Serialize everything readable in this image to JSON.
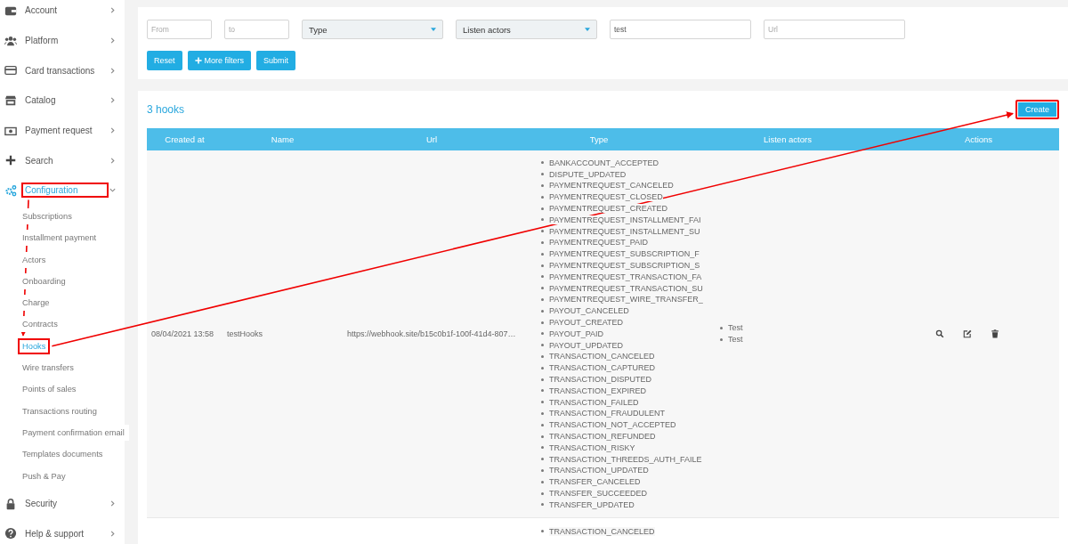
{
  "sidebar": {
    "items": [
      {
        "label": "Account",
        "kind": "wallet",
        "expanded": false,
        "selected": false,
        "highlighted": false
      },
      {
        "label": "Platform",
        "kind": "users",
        "expanded": false,
        "selected": false,
        "highlighted": false
      },
      {
        "label": "Card transactions",
        "kind": "card",
        "expanded": false,
        "selected": false,
        "highlighted": false
      },
      {
        "label": "Catalog",
        "kind": "store",
        "expanded": false,
        "selected": false,
        "highlighted": false
      },
      {
        "label": "Payment request",
        "kind": "money",
        "expanded": false,
        "selected": false,
        "highlighted": false
      },
      {
        "label": "Search",
        "kind": "plus",
        "expanded": false,
        "selected": false,
        "highlighted": false
      },
      {
        "label": "Configuration",
        "kind": "cogs",
        "expanded": true,
        "selected": true,
        "highlighted": true,
        "children": [
          {
            "label": "Subscriptions",
            "selected": false,
            "highlighted": false
          },
          {
            "label": "Installment payment",
            "selected": false,
            "highlighted": false
          },
          {
            "label": "Actors",
            "selected": false,
            "highlighted": false
          },
          {
            "label": "Onboarding",
            "selected": false,
            "highlighted": false
          },
          {
            "label": "Charge",
            "selected": false,
            "highlighted": false
          },
          {
            "label": "Contracts",
            "selected": false,
            "highlighted": false
          },
          {
            "label": "Hooks",
            "selected": true,
            "highlighted": true
          },
          {
            "label": "Wire transfers",
            "selected": false,
            "highlighted": false
          },
          {
            "label": "Points of sales",
            "selected": false,
            "highlighted": false
          },
          {
            "label": "Transactions routing",
            "selected": false,
            "highlighted": false
          },
          {
            "label": "Payment confirmation email",
            "selected": false,
            "highlighted": false
          },
          {
            "label": "Templates documents",
            "selected": false,
            "highlighted": false
          },
          {
            "label": "Push & Pay",
            "selected": false,
            "highlighted": false
          }
        ]
      },
      {
        "label": "Security",
        "kind": "lock",
        "expanded": false,
        "selected": false,
        "highlighted": false
      },
      {
        "label": "Help & support",
        "kind": "question",
        "expanded": false,
        "selected": false,
        "highlighted": false
      }
    ]
  },
  "filters": {
    "fields": [
      {
        "kind": "input",
        "placeholder": "From"
      },
      {
        "kind": "input",
        "placeholder": "to"
      },
      {
        "kind": "select",
        "value": "Type"
      },
      {
        "kind": "select",
        "value": "Listen actors"
      },
      {
        "kind": "input",
        "value": "test"
      },
      {
        "kind": "input",
        "placeholder": "Url"
      }
    ],
    "buttons": [
      {
        "label": "Reset",
        "kind": "plain"
      },
      {
        "label": "More filters",
        "kind": "add"
      },
      {
        "label": "Submit",
        "kind": "plain"
      }
    ]
  },
  "hooks": {
    "count": "3 hooks",
    "create_button": {
      "label": "Create",
      "highlighted": true
    },
    "table": {
      "columns": [
        "Created at",
        "Name",
        "Url",
        "Type",
        "Listen actors",
        "Actions"
      ],
      "rows": [
        {
          "created_at": "08/04/2021 13:58",
          "name": "testHooks",
          "url": "https://webhook.site/b15c0b1f-100f-41d4-807…",
          "types": [
            "BANKACCOUNT_ACCEPTED",
            "DISPUTE_UPDATED",
            "PAYMENTREQUEST_CANCELED",
            "PAYMENTREQUEST_CLOSED",
            "PAYMENTREQUEST_CREATED",
            "PAYMENTREQUEST_INSTALLMENT_FAI",
            "PAYMENTREQUEST_INSTALLMENT_SU",
            "PAYMENTREQUEST_PAID",
            "PAYMENTREQUEST_SUBSCRIPTION_F",
            "PAYMENTREQUEST_SUBSCRIPTION_S",
            "PAYMENTREQUEST_TRANSACTION_FA",
            "PAYMENTREQUEST_TRANSACTION_SU",
            "PAYMENTREQUEST_WIRE_TRANSFER_",
            "PAYOUT_CANCELED",
            "PAYOUT_CREATED",
            "PAYOUT_PAID",
            "PAYOUT_UPDATED",
            "TRANSACTION_CANCELED",
            "TRANSACTION_CAPTURED",
            "TRANSACTION_DISPUTED",
            "TRANSACTION_EXPIRED",
            "TRANSACTION_FAILED",
            "TRANSACTION_FRAUDULENT",
            "TRANSACTION_NOT_ACCEPTED",
            "TRANSACTION_REFUNDED",
            "TRANSACTION_RISKY",
            "TRANSACTION_THREEDS_AUTH_FAILE",
            "TRANSACTION_UPDATED",
            "TRANSFER_CANCELED",
            "TRANSFER_SUCCEEDED",
            "TRANSFER_UPDATED"
          ],
          "listen_actors": [
            "Test",
            "Test"
          ]
        },
        {
          "types": [
            "TRANSACTION_CANCELED"
          ]
        }
      ]
    }
  }
}
